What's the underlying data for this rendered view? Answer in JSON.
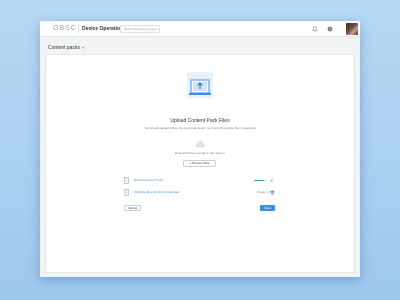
{
  "header": {
    "logo_text": "OBSC",
    "app_title": "Device Operations",
    "search_placeholder": "Search devices & groups",
    "icons": [
      "bell-icon",
      "help-icon"
    ]
  },
  "page": {
    "title": "Content packs",
    "title_chevron": "▾"
  },
  "upload": {
    "title": "Upload Content Pack Files",
    "subtitle": "You should upload 2 files. Content pack binary (.pcr) and Properties file (.properties)",
    "drop_text": "Drag and Drop your file in this area or",
    "browse_label": "Browse Files",
    "browse_plus": "+"
  },
  "files": [
    {
      "name": "Deviced-Linux-7.5.pcr",
      "progress": 0.8,
      "status": "",
      "action": "✕"
    },
    {
      "name": "2018-09-06 at 12-30.22.properties",
      "progress": null,
      "status": "Ready 1 Kb",
      "action": "🗑"
    }
  ],
  "footer": {
    "cancel_label": "Cancel",
    "save_label": "Save"
  },
  "colors": {
    "accent": "#3b8ee6",
    "progress": "#34b565",
    "link": "#3a7fd5",
    "background": "#a8cdef"
  }
}
